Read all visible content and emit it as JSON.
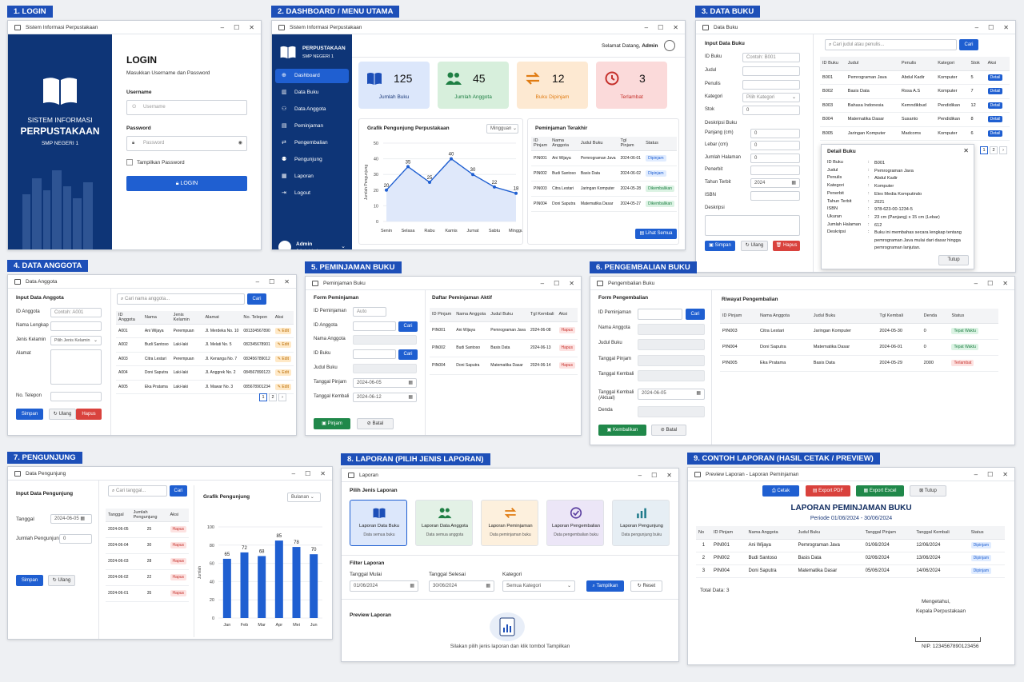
{
  "sections": {
    "s1": "1. LOGIN",
    "s2": "2. DASHBOARD / MENU UTAMA",
    "s3": "3. DATA BUKU",
    "s4": "4. DATA ANGGOTA",
    "s5": "5. PEMINJAMAN BUKU",
    "s6": "6. PENGEMBALIAN BUKU",
    "s7": "7. PENGUNJUNG",
    "s8": "8. LAPORAN (PILIH JENIS LAPORAN)",
    "s9": "9. CONTOH LAPORAN (HASIL CETAK / PREVIEW)"
  },
  "login": {
    "wintitle": "Sistem Informasi Perpustakaan",
    "brand1": "SISTEM INFORMASI",
    "brand2": "PERPUSTAKAAN",
    "brand3": "SMP NEGERI 1",
    "title": "LOGIN",
    "subtitle": "Masukkan Username dan Password",
    "user_label": "Username",
    "user_ph": "Username",
    "pass_label": "Password",
    "pass_ph": "Password",
    "show": "Tampilkan Password",
    "btn": "LOGIN"
  },
  "dash": {
    "wintitle": "Sistem Informasi Perpustakaan",
    "brand1": "PERPUSTAKAAN",
    "brand2": "SMP NEGERI 1",
    "menu": [
      "Dashboard",
      "Data Buku",
      "Data Anggota",
      "Peminjaman",
      "Pengembalian",
      "Pengunjung",
      "Laporan",
      "Logout"
    ],
    "welcome": "Selamat Datang,",
    "user": "Admin",
    "admin": "Admin",
    "role": "Administrator",
    "cards": [
      {
        "n": "125",
        "l": "Jumlah Buku",
        "bg": "#dce7fb",
        "c": "#1d4fb8"
      },
      {
        "n": "45",
        "l": "Jumlah Anggota",
        "bg": "#d7efdc",
        "c": "#1e7f43"
      },
      {
        "n": "12",
        "l": "Buku Dipinjam",
        "bg": "#fde9d2",
        "c": "#e07b12"
      },
      {
        "n": "3",
        "l": "Terlambat",
        "bg": "#fbdada",
        "c": "#c5302b"
      }
    ],
    "graph_title": "Grafik Pengunjung Perpustakaan",
    "graph_period": "Mingguan",
    "ylabel": "Jumlah Pengunjung",
    "recent_title": "Peminjaman Terakhir",
    "recent_head": [
      "ID Pinjam",
      "Nama Anggota",
      "Judul Buku",
      "Tgl Pinjam",
      "Status"
    ],
    "recent": [
      [
        "PIN001",
        "Ani Wijaya",
        "Pemrograman Java",
        "2024-06-01",
        "Dipinjam"
      ],
      [
        "PIN002",
        "Budi Santoso",
        "Basis Data",
        "2024-06-02",
        "Dipinjam"
      ],
      [
        "PIN003",
        "Citra Lestari",
        "Jaringan Komputer",
        "2024-05-28",
        "Dikembalikan"
      ],
      [
        "PIN004",
        "Doni Saputra",
        "Matematika Dasar",
        "2024-05-27",
        "Dikembalikan"
      ]
    ],
    "see_all": "Lihat Semua"
  },
  "chart_data": [
    {
      "type": "area",
      "title": "Grafik Pengunjung Perpustakaan",
      "ylabel": "Jumlah Pengunjung",
      "categories": [
        "Senin",
        "Selasa",
        "Rabu",
        "Kamis",
        "Jumat",
        "Sabtu",
        "Minggu"
      ],
      "values": [
        20,
        35,
        25,
        40,
        30,
        22,
        18
      ],
      "ylim": [
        0,
        50
      ],
      "yticks": [
        0,
        10,
        20,
        30,
        40,
        50
      ]
    },
    {
      "type": "bar",
      "title": "Grafik Pengunjung",
      "ylabel": "Jumlah",
      "categories": [
        "Jan",
        "Feb",
        "Mar",
        "Apr",
        "Mei",
        "Jun"
      ],
      "values": [
        65,
        72,
        68,
        85,
        78,
        70
      ],
      "ylim": [
        0,
        100
      ],
      "yticks": [
        0,
        20,
        40,
        60,
        80,
        100
      ]
    }
  ],
  "buku": {
    "wintitle": "Data Buku",
    "form_title": "Input Data Buku",
    "labels": [
      "ID Buku",
      "Judul",
      "Penulis",
      "Kategori",
      "Stok",
      "Deskripsi Buku",
      "Panjang (cm)",
      "Lebar (cm)",
      "Jumlah Halaman",
      "Penerbit",
      "Tahun Terbit",
      "ISBN",
      "Deskripsi"
    ],
    "id_ph": "Contoh: B001",
    "kat_ph": "Pilih Kategori",
    "stok": "0",
    "p": "0",
    "l": "0",
    "jh": "0",
    "tahun": "2024",
    "save": "Simpan",
    "reset": "Ulang",
    "del": "Hapus",
    "search_ph": "Cari judul atau penulis...",
    "search_btn": "Cari",
    "head": [
      "ID Buku",
      "Judul",
      "Penulis",
      "Kategori",
      "Stok",
      "Aksi"
    ],
    "rows": [
      [
        "B001",
        "Pemrograman Java",
        "Abdul Kadir",
        "Komputer",
        "5"
      ],
      [
        "B002",
        "Basis Data",
        "Rosa A.S",
        "Komputer",
        "7"
      ],
      [
        "B003",
        "Bahasa Indonesia",
        "Kemndikbud",
        "Pendidikan",
        "12"
      ],
      [
        "B004",
        "Matematika Dasar",
        "Susanto",
        "Pendidikan",
        "8"
      ],
      [
        "B005",
        "Jaringan Komputer",
        "Madcoms",
        "Komputer",
        "6"
      ]
    ],
    "detail_btn": "Detail",
    "pages": [
      "1",
      "2",
      "›"
    ],
    "detail_title": "Detail Buku",
    "detail": [
      [
        "ID Buku",
        "B001"
      ],
      [
        "Judul",
        "Pemrograman Java"
      ],
      [
        "Penulis",
        "Abdul Kadir"
      ],
      [
        "Kategori",
        "Komputer"
      ],
      [
        "Penerbit",
        "Elex Media Komputindo"
      ],
      [
        "Tahun Terbit",
        "2021"
      ],
      [
        "ISBN",
        "978-623-00-1234-5"
      ],
      [
        "Ukuran",
        "23 cm (Panjang) x 15 cm (Lebar)"
      ],
      [
        "Jumlah Halaman",
        "612"
      ],
      [
        "Deskripsi",
        "Buku ini membahas secara lengkap tentang pemrograman Java mulai dari dasar hingga pemrograman lanjutan."
      ]
    ],
    "close": "Tutup"
  },
  "anggota": {
    "wintitle": "Data Anggota",
    "form_title": "Input Data Anggota",
    "labels": [
      "ID Anggota",
      "Nama Lengkap",
      "Jenis Kelamin",
      "Alamat",
      "No. Telepon"
    ],
    "id_ph": "Contoh: A001",
    "jk_ph": "Pilih Jenis Kelamin",
    "save": "Simpan",
    "reset": "Ulang",
    "del": "Hapus",
    "search_ph": "Cari nama anggota...",
    "search_btn": "Cari",
    "head": [
      "ID Anggota",
      "Nama",
      "Jenis Kelamin",
      "Alamat",
      "No. Telepon",
      "Aksi"
    ],
    "rows": [
      [
        "A001",
        "Ani Wijaya",
        "Perempuan",
        "Jl. Merdeka No. 10",
        "081334567890"
      ],
      [
        "A002",
        "Budi Santoso",
        "Laki-laki",
        "Jl. Melati No. 5",
        "082345678901"
      ],
      [
        "A003",
        "Citra Lestari",
        "Perempuan",
        "Jl. Kenanga No. 7",
        "083456789012"
      ],
      [
        "A004",
        "Doni Saputra",
        "Laki-laki",
        "Jl. Anggrek No. 2",
        "084567890123"
      ],
      [
        "A005",
        "Eka Pratama",
        "Laki-laki",
        "Jl. Mawar No. 3",
        "085678901234"
      ]
    ],
    "edit": "Edit",
    "pages": [
      "1",
      "2",
      "›"
    ]
  },
  "pinjam": {
    "wintitle": "Peminjaman Buku",
    "form_title": "Form Peminjaman",
    "labels": [
      "ID Peminjaman",
      "ID Anggota",
      "Nama Anggota",
      "ID Buku",
      "Judul Buku",
      "Tanggal Pinjam",
      "Tanggal Kembali"
    ],
    "auto": "Auto",
    "cari": "Cari",
    "tp": "2024-06-05",
    "tk": "2024-06-12",
    "btn": "Pinjam",
    "cancel": "Batal",
    "list_title": "Daftar Peminjaman Aktif",
    "head": [
      "ID Pinjam",
      "Nama Anggota",
      "Judul Buku",
      "Tgl Kembali",
      "Aksi"
    ],
    "rows": [
      [
        "PIN001",
        "Ani Wijaya",
        "Pemrograman Java",
        "2024-06-08"
      ],
      [
        "PIN002",
        "Budi Santoso",
        "Basis Data",
        "2024-06-13"
      ],
      [
        "PIN004",
        "Doni Saputra",
        "Matematika Dasar",
        "2024-06-14"
      ]
    ],
    "del": "Hapus"
  },
  "kembali": {
    "wintitle": "Pengembalian Buku",
    "form_title": "Form Pengembalian",
    "labels": [
      "ID Peminjaman",
      "Nama Anggota",
      "Judul Buku",
      "Tanggal Pinjam",
      "Tanggal Kembali",
      "Tanggal Kembali (Aktual)",
      "Denda"
    ],
    "cari": "Cari",
    "aktual": "2024-06-05",
    "btn": "Kembalikan",
    "cancel": "Batal",
    "list_title": "Riwayat Pengembalian",
    "head": [
      "ID Pinjam",
      "Nama Anggota",
      "Judul Buku",
      "Tgl Kembali",
      "Denda",
      "Status"
    ],
    "rows": [
      [
        "PIN003",
        "Citra Lestari",
        "Jaringan Komputer",
        "2024-05-30",
        "0",
        "Tepat Waktu"
      ],
      [
        "PIN004",
        "Doni Saputra",
        "Matematika Dasar",
        "2024-06-01",
        "0",
        "Tepat Waktu"
      ],
      [
        "PIN005",
        "Eka Pratama",
        "Basis Data",
        "2024-05-29",
        "2000",
        "Terlambat"
      ]
    ]
  },
  "pengunjung": {
    "wintitle": "Data Pengunjung",
    "form_title": "Input Data Pengunjung",
    "tgl_label": "Tanggal",
    "tgl": "2024-06-05",
    "jml_label": "Jumlah Pengunjung",
    "jml": "0",
    "save": "Simpan",
    "reset": "Ulang",
    "search_ph": "Cari tanggal...",
    "search_btn": "Cari",
    "head": [
      "Tanggal",
      "Jumlah Pengunjung",
      "Aksi"
    ],
    "rows": [
      [
        "2024-06-05",
        "25"
      ],
      [
        "2024-06-04",
        "30"
      ],
      [
        "2024-06-03",
        "28"
      ],
      [
        "2024-06-02",
        "22"
      ],
      [
        "2024-06-01",
        "35"
      ]
    ],
    "del": "Hapus",
    "graph_title": "Grafik Pengunjung",
    "period": "Bulanan"
  },
  "laporan": {
    "wintitle": "Laporan",
    "pick": "Pilih Jenis Laporan",
    "types": [
      {
        "t": "Laporan Data Buku",
        "s": "Data semua buku",
        "bg": "#dce7fb",
        "c": "#1d4fb8",
        "ic": "book"
      },
      {
        "t": "Laporan Data Anggota",
        "s": "Data semua anggota",
        "bg": "#e3f1e6",
        "c": "#1e7f43",
        "ic": "users"
      },
      {
        "t": "Laporan Peminjaman",
        "s": "Data peminjaman buku",
        "bg": "#fdf0dd",
        "c": "#e07b12",
        "ic": "swap"
      },
      {
        "t": "Laporan Pengembalian",
        "s": "Data pengembalian buku",
        "bg": "#ece6f7",
        "c": "#5b3fa0",
        "ic": "check"
      },
      {
        "t": "Laporan Pengunjung",
        "s": "Data pengunjung buku",
        "bg": "#e6eef4",
        "c": "#1e7a8a",
        "ic": "bars"
      }
    ],
    "filter": "Filter Laporan",
    "start_label": "Tanggal Mulai",
    "start": "01/06/2024",
    "end_label": "Tanggal Selesai",
    "end": "30/06/2024",
    "cat_label": "Kategori",
    "cat": "Semua Kategori",
    "show": "Tampilkan",
    "reset": "Reset",
    "preview": "Preview Laporan",
    "hint": "Silakan pilih jenis laporan dan klik tombol Tampilkan"
  },
  "report": {
    "wintitle": "Preview Laporan - Laporan Peminjaman",
    "print": "Cetak",
    "pdf": "Export PDF",
    "excel": "Export Excel",
    "close": "Tutup",
    "title": "LAPORAN PEMINJAMAN BUKU",
    "period": "Periode 01/06/2024 - 30/06/2024",
    "head": [
      "No",
      "ID Pinjam",
      "Nama Anggota",
      "Judul Buku",
      "Tanggal Pinjam",
      "Tanggal Kembali",
      "Status"
    ],
    "rows": [
      [
        "1",
        "PIN001",
        "Ani Wijaya",
        "Pemrograman Java",
        "01/06/2024",
        "12/06/2024",
        "Dipinjam"
      ],
      [
        "2",
        "PIN002",
        "Budi Santoso",
        "Basis Data",
        "02/06/2024",
        "13/06/2024",
        "Dipinjam"
      ],
      [
        "3",
        "PIN004",
        "Doni Saputra",
        "Matematika Dasar",
        "05/06/2024",
        "14/06/2024",
        "Dipinjam"
      ]
    ],
    "total": "Total Data: 3",
    "know": "Mengetahui,",
    "head_lib": "Kepala Perpustakaan",
    "nip": "NIP. 1234567890123456"
  }
}
